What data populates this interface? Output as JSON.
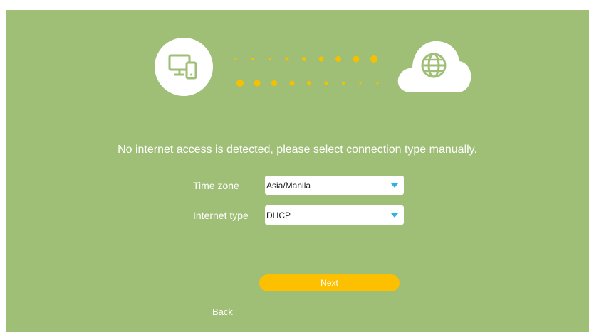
{
  "illustration": {
    "left_icon": "devices-icon",
    "right_icon": "globe-icon",
    "accent_color": "#f5c000"
  },
  "message": "No internet access is detected, please select connection type manually.",
  "form": {
    "time_zone": {
      "label": "Time zone",
      "value": "Asia/Manila"
    },
    "internet_type": {
      "label": "Internet type",
      "value": "DHCP"
    }
  },
  "buttons": {
    "next": "Next",
    "back": "Back"
  },
  "colors": {
    "background": "#9fbe76",
    "button": "#fcc000",
    "dropdown_arrow": "#2ab4e6"
  }
}
